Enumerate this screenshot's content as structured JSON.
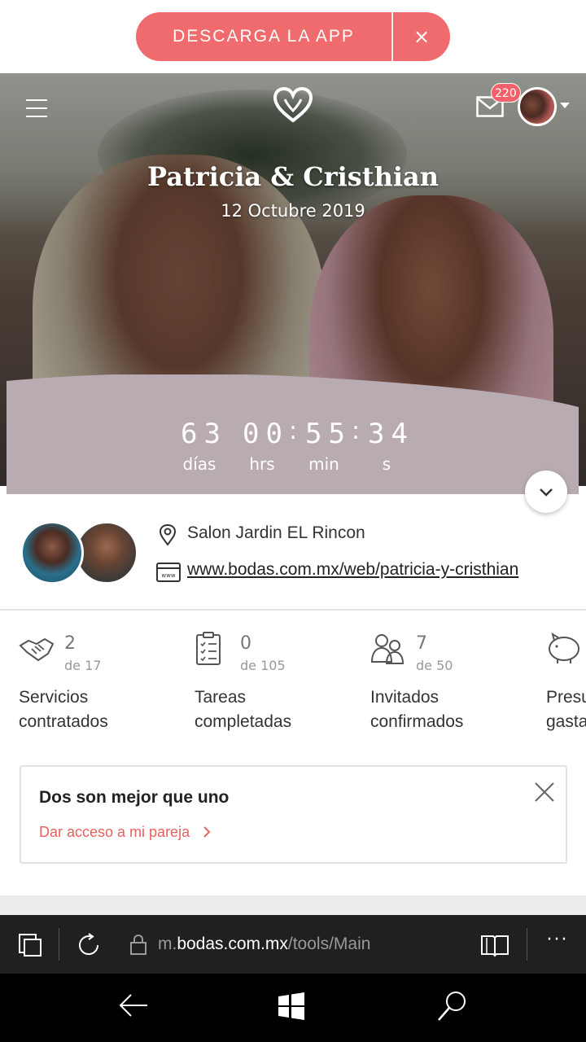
{
  "banner": {
    "download_label": "DESCARGA LA APP",
    "close_glyph": "×"
  },
  "header": {
    "mail_badge": "220"
  },
  "hero": {
    "couple_names": "Patricia & Cristhian",
    "wedding_date": "12 Octubre 2019",
    "countdown": {
      "days": "63",
      "hours": "00",
      "minutes": "55",
      "seconds": "34",
      "days_label": "días",
      "hours_label": "hrs",
      "minutes_label": "min",
      "seconds_label": "s"
    }
  },
  "info": {
    "venue": "Salon Jardin EL Rincon",
    "website": "www.bodas.com.mx/web/patricia-y-cristhian"
  },
  "stats": [
    {
      "value": "2",
      "total": "de 17",
      "label_line1": "Servicios",
      "label_line2": "contratados",
      "icon": "handshake-icon"
    },
    {
      "value": "0",
      "total": "de 105",
      "label_line1": "Tareas",
      "label_line2": "completadas",
      "icon": "checklist-icon"
    },
    {
      "value": "7",
      "total": "de 50",
      "label_line1": "Invitados",
      "label_line2": "confirmados",
      "icon": "guests-icon"
    },
    {
      "value": "",
      "total": "",
      "label_line1": "Presu",
      "label_line2": "gasta",
      "icon": "piggy-bank-icon"
    }
  ],
  "partner_card": {
    "title": "Dos son mejor que uno",
    "link": "Dar acceso a mi pareja"
  },
  "browser": {
    "url_prefix": "m.",
    "url_domain": "bodas.com.mx",
    "url_path": "/tools/Main",
    "more_glyph": "···"
  },
  "colors": {
    "brand_coral": "#f06b6e",
    "countdown_panel": "#b9abb2",
    "link_coral": "#e8605f"
  }
}
